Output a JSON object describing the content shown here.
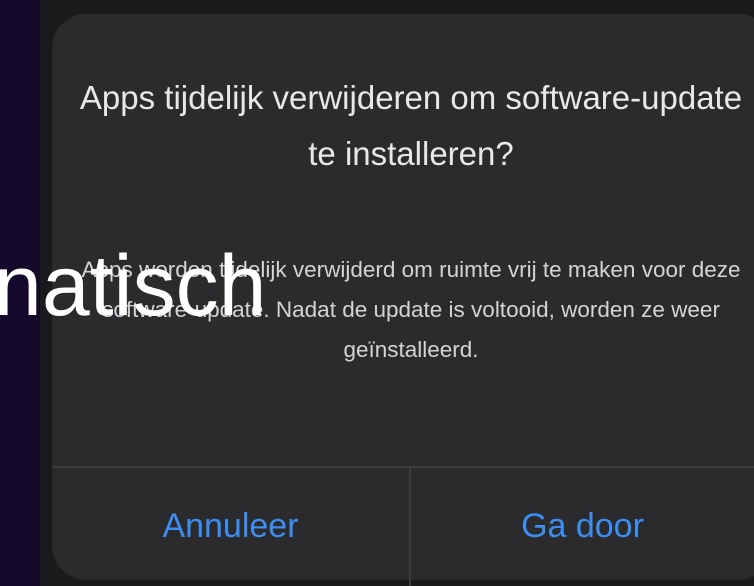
{
  "alert": {
    "title": "Apps tijdelijk verwijderen om software-update te installeren?",
    "message": "Apps worden tijdelijk verwijderd om ruimte vrij te maken voor deze software-update. Nadat de update is voltooid, worden ze weer geïnstalleerd.",
    "buttons": {
      "cancel": "Annuleer",
      "continue": "Ga door"
    }
  },
  "overlay": {
    "caption": "natisch"
  },
  "colors": {
    "background": "#14092a",
    "alert_background": "#2b2b2d",
    "button_text": "#3d8ef2",
    "title_text": "#e8e8ea"
  }
}
